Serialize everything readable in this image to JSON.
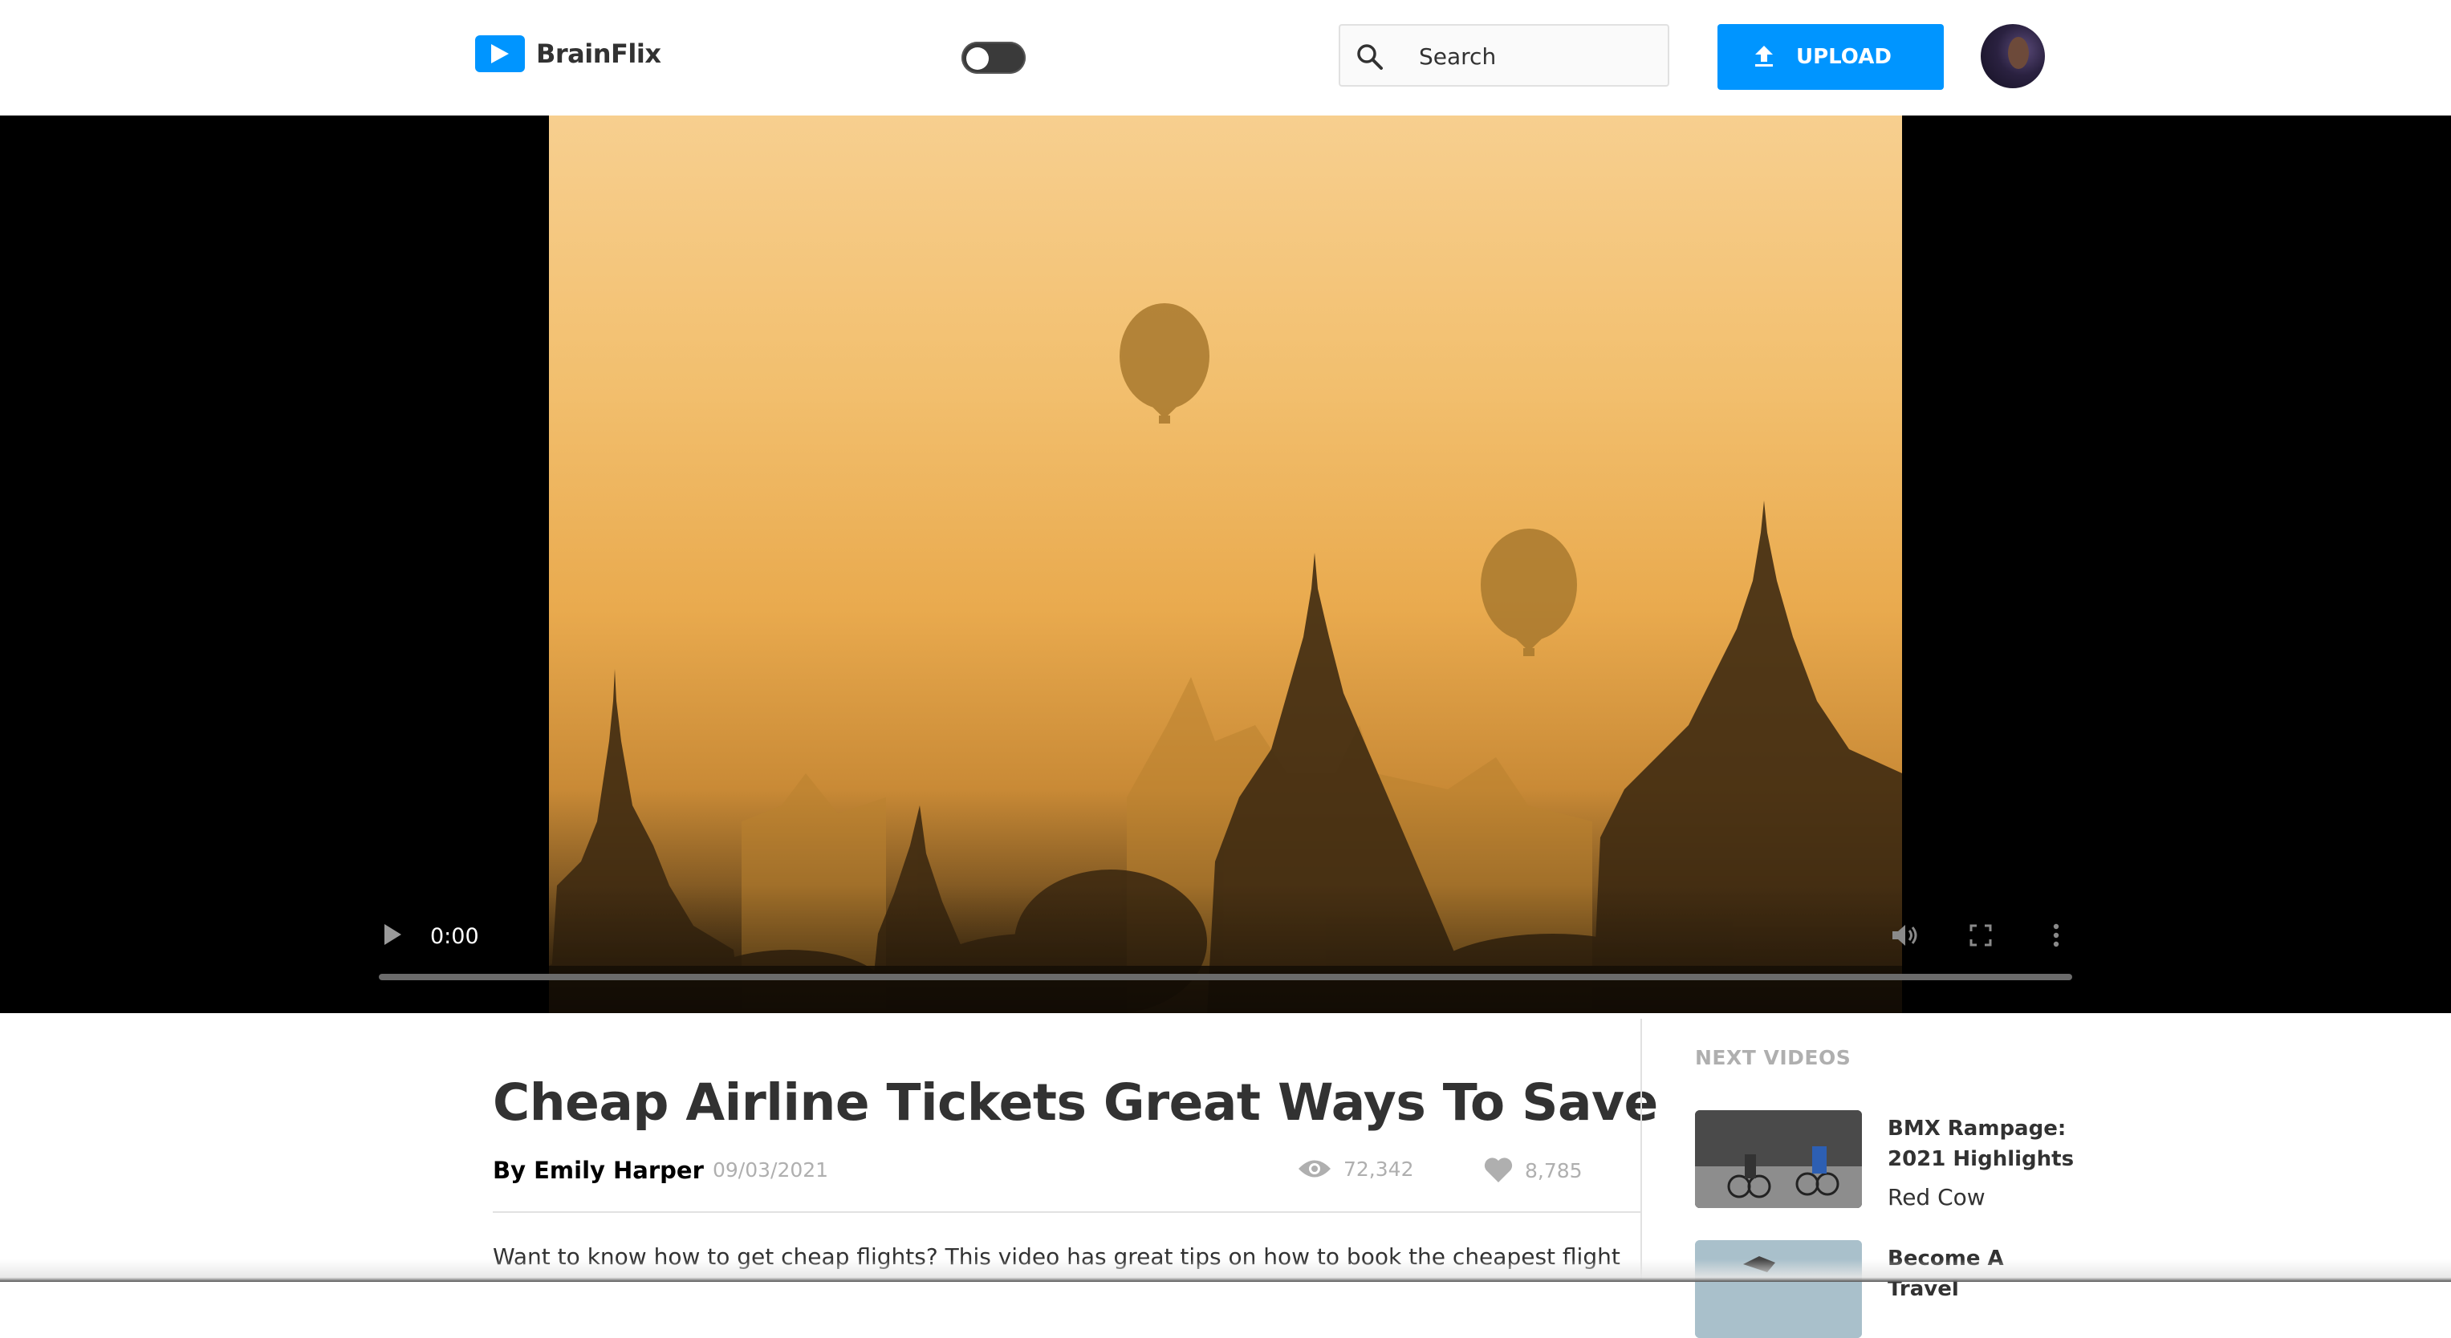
{
  "app": {
    "name": "BrainFlix"
  },
  "header": {
    "search_placeholder": "Search",
    "upload_label": "UPLOAD"
  },
  "player": {
    "time": "0:00",
    "progress": 0
  },
  "video": {
    "title": "Cheap Airline Tickets Great Ways To Save",
    "author": "By Emily Harper",
    "date": "09/03/2021",
    "views": "72,342",
    "likes": "8,785",
    "description": "Want to know how to get cheap flights? This video has great tips on how to book the cheapest flight"
  },
  "next_videos": {
    "heading": "NEXT VIDEOS",
    "items": [
      {
        "title": "BMX Rampage: 2021 Highlights",
        "channel": "Red Cow"
      },
      {
        "title": "Become A Travel"
      }
    ]
  },
  "colors": {
    "brand": "#0095ff",
    "text": "#323232",
    "muted": "#afafaf",
    "border": "#e1e1e1"
  }
}
